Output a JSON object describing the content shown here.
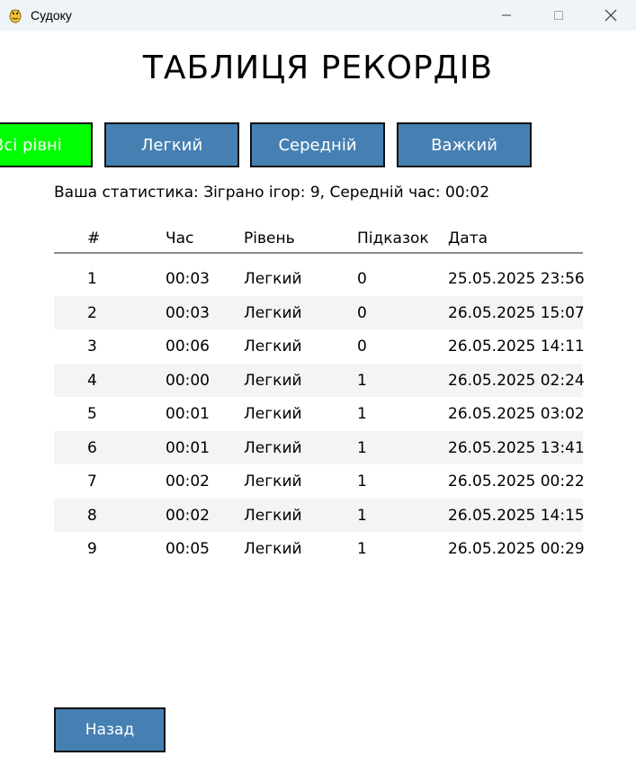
{
  "window": {
    "title": "Судоку",
    "minimize_icon": "minimize-icon",
    "maximize_icon": "maximize-icon",
    "close_icon": "close-icon"
  },
  "page": {
    "title": "ТАБЛИЦЯ РЕКОРДІВ"
  },
  "filters": [
    {
      "label": "Всі рівні",
      "active": true
    },
    {
      "label": "Легкий",
      "active": false
    },
    {
      "label": "Середній",
      "active": false
    },
    {
      "label": "Важкий",
      "active": false
    }
  ],
  "stats": {
    "text": "Ваша статистика: Зіграно ігор: 9, Середній час: 00:02"
  },
  "table": {
    "headers": [
      "#",
      "Час",
      "Рівень",
      "Підказок",
      "Дата"
    ],
    "rows": [
      [
        "1",
        "00:03",
        "Легкий",
        "0",
        "25.05.2025 23:56"
      ],
      [
        "2",
        "00:03",
        "Легкий",
        "0",
        "26.05.2025 15:07"
      ],
      [
        "3",
        "00:06",
        "Легкий",
        "0",
        "26.05.2025 14:11"
      ],
      [
        "4",
        "00:00",
        "Легкий",
        "1",
        "26.05.2025 02:24"
      ],
      [
        "5",
        "00:01",
        "Легкий",
        "1",
        "26.05.2025 03:02"
      ],
      [
        "6",
        "00:01",
        "Легкий",
        "1",
        "26.05.2025 13:41"
      ],
      [
        "7",
        "00:02",
        "Легкий",
        "1",
        "26.05.2025 00:22"
      ],
      [
        "8",
        "00:02",
        "Легкий",
        "1",
        "26.05.2025 14:15"
      ],
      [
        "9",
        "00:05",
        "Легкий",
        "1",
        "26.05.2025 00:29"
      ]
    ]
  },
  "back_button": {
    "label": "Назад"
  },
  "colors": {
    "button": "#4680b2",
    "active_button": "#00ff00",
    "titlebar": "#eff4f9",
    "row_alt": "#f4f4f4"
  }
}
